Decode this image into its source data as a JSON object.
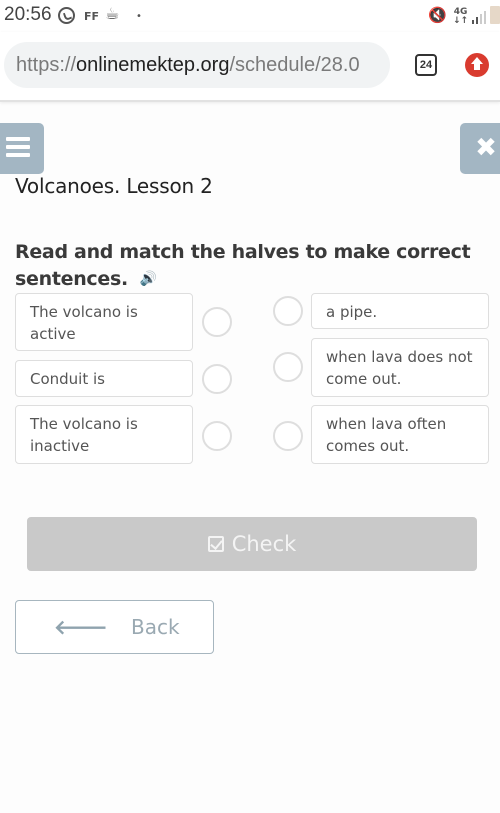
{
  "status_bar": {
    "time": "20:56",
    "icons": [
      "whatsapp-icon",
      "ff-icon",
      "app-icon",
      "dot-icon",
      "mute-icon",
      "network-4g-icon",
      "signal-icon",
      "battery-icon"
    ],
    "ff_label": "FF",
    "network_label": "4G",
    "network_arrows": "↓↑"
  },
  "browser": {
    "url_scheme": "https://",
    "url_domain": "onlinemektep.org",
    "url_path": "/schedule/28.0",
    "tab_count": "24",
    "update_color": "#d93b2f"
  },
  "page": {
    "lesson_title": "Volcanoes. Lesson 2",
    "instruction": "Read and match the halves to make correct sentences.",
    "accent_color": "#a3b6c3",
    "left_items": [
      {
        "text": "The volcano is active"
      },
      {
        "text": "Conduit is"
      },
      {
        "text": "The volcano is inactive"
      }
    ],
    "right_items": [
      {
        "text": "a pipe."
      },
      {
        "text": "when lava does not come out."
      },
      {
        "text": "when lava often comes out."
      }
    ],
    "check_label": "Check",
    "back_label": "Back"
  }
}
